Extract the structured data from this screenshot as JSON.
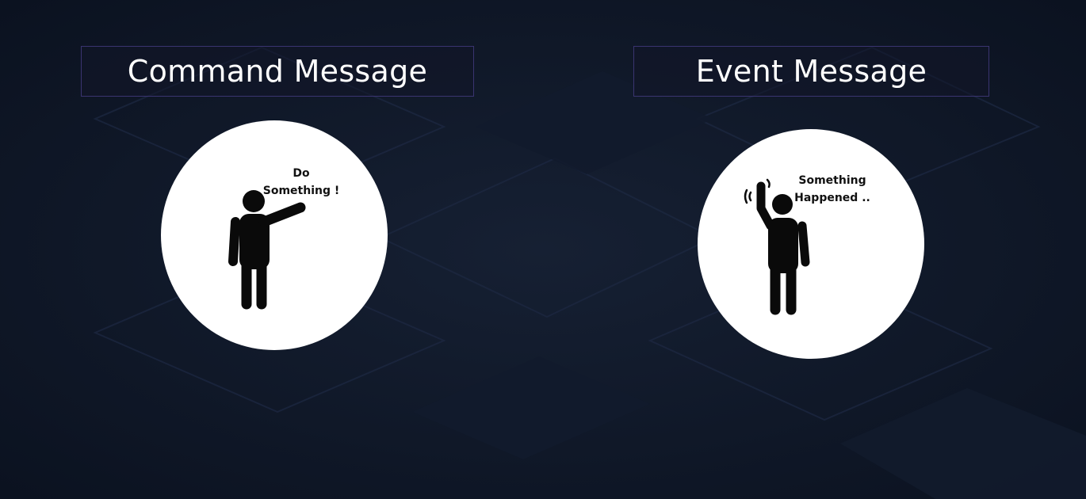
{
  "background": {
    "base_color": "#0e1726",
    "pattern_color": "#1a2436"
  },
  "command": {
    "title": "Command Message",
    "speech_line1": "Do",
    "speech_line2": "Something !",
    "icon": "person-pointing-icon"
  },
  "event": {
    "title": "Event Message",
    "speech_line1": "Something",
    "speech_line2": "Happened ..",
    "icon": "person-waving-icon"
  }
}
